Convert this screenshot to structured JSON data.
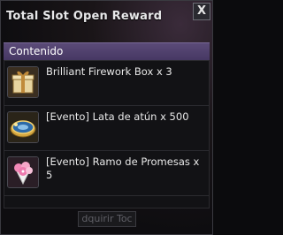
{
  "window": {
    "title": "Total Slot Open Reward",
    "close_label": "X"
  },
  "section": {
    "header": "Contenido"
  },
  "items": [
    {
      "name": "Brilliant Firework Box x 3",
      "icon": "gift-box-icon"
    },
    {
      "name": "[Evento] Lata de atún x 500",
      "icon": "tuna-can-icon"
    },
    {
      "name": "[Evento] Ramo de Promesas x 5",
      "icon": "flower-bouquet-icon"
    }
  ],
  "footer": {
    "button_label": "dquirir Toc"
  }
}
